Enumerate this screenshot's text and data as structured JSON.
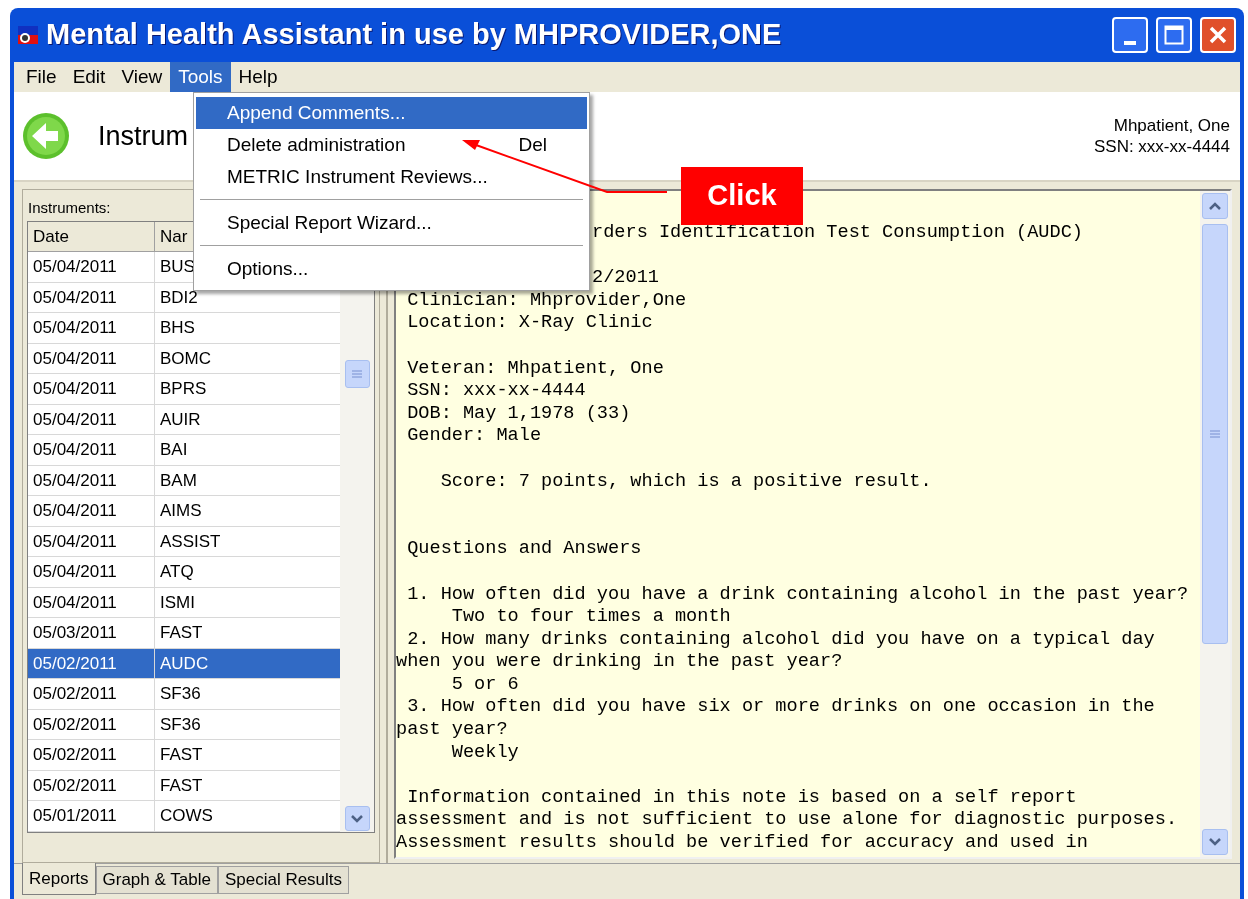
{
  "window": {
    "title": "Mental Health Assistant in use by MHPROVIDER,ONE"
  },
  "menu_bar": [
    {
      "label": "File",
      "selected": false
    },
    {
      "label": "Edit",
      "selected": false
    },
    {
      "label": "View",
      "selected": false
    },
    {
      "label": "Tools",
      "selected": true
    },
    {
      "label": "Help",
      "selected": false
    }
  ],
  "tools_menu": [
    {
      "kind": "item",
      "label": "Append Comments...",
      "selected": true
    },
    {
      "kind": "item",
      "label": "Delete administration",
      "shortcut": "Del",
      "selected": false
    },
    {
      "kind": "item",
      "label": "METRIC Instrument Reviews...",
      "selected": false
    },
    {
      "kind": "separator"
    },
    {
      "kind": "item",
      "label": "Special Report Wizard...",
      "selected": false
    },
    {
      "kind": "separator"
    },
    {
      "kind": "item",
      "label": "Options...",
      "selected": false
    }
  ],
  "header": {
    "title": "Instrum",
    "patient_name": "Mhpatient, One",
    "patient_ssn": "SSN: xxx-xx-4444"
  },
  "instruments": {
    "label": "Instruments:",
    "columns": [
      "Date",
      "Nar"
    ],
    "rows": [
      {
        "date": "05/04/2011",
        "name": "BUS",
        "selected": false
      },
      {
        "date": "05/04/2011",
        "name": "BDI2",
        "selected": false
      },
      {
        "date": "05/04/2011",
        "name": "BHS",
        "selected": false
      },
      {
        "date": "05/04/2011",
        "name": "BOMC",
        "selected": false
      },
      {
        "date": "05/04/2011",
        "name": "BPRS",
        "selected": false
      },
      {
        "date": "05/04/2011",
        "name": "AUIR",
        "selected": false
      },
      {
        "date": "05/04/2011",
        "name": "BAI",
        "selected": false
      },
      {
        "date": "05/04/2011",
        "name": "BAM",
        "selected": false
      },
      {
        "date": "05/04/2011",
        "name": "AIMS",
        "selected": false
      },
      {
        "date": "05/04/2011",
        "name": "ASSIST",
        "selected": false
      },
      {
        "date": "05/04/2011",
        "name": "ATQ",
        "selected": false
      },
      {
        "date": "05/04/2011",
        "name": "ISMI",
        "selected": false
      },
      {
        "date": "05/03/2011",
        "name": "FAST",
        "selected": false
      },
      {
        "date": "05/02/2011",
        "name": "AUDC",
        "selected": true
      },
      {
        "date": "05/02/2011",
        "name": "SF36",
        "selected": false
      },
      {
        "date": "05/02/2011",
        "name": "SF36",
        "selected": false
      },
      {
        "date": "05/02/2011",
        "name": "FAST",
        "selected": false
      },
      {
        "date": "05/02/2011",
        "name": "FAST",
        "selected": false
      },
      {
        "date": "05/01/2011",
        "name": "COWS",
        "selected": false
      }
    ]
  },
  "report": {
    "lines": [
      {
        "kind": "cut",
        "text": "rders Identification Test Consumption (AUDC)"
      },
      {
        "kind": "blank"
      },
      {
        "kind": "cut",
        "text": "2/2011"
      },
      {
        "kind": "line",
        "text": " Clinician: Mhprovider,One"
      },
      {
        "kind": "line",
        "text": " Location: X-Ray Clinic"
      },
      {
        "kind": "blank"
      },
      {
        "kind": "line",
        "text": " Veteran: Mhpatient, One"
      },
      {
        "kind": "line",
        "text": " SSN: xxx-xx-4444"
      },
      {
        "kind": "line",
        "text": " DOB: May 1,1978 (33)"
      },
      {
        "kind": "line",
        "text": " Gender: Male"
      },
      {
        "kind": "blank"
      },
      {
        "kind": "line",
        "text": "    Score: 7 points, which is a positive result."
      },
      {
        "kind": "blank"
      },
      {
        "kind": "blank"
      },
      {
        "kind": "line",
        "text": " Questions and Answers"
      },
      {
        "kind": "blank"
      },
      {
        "kind": "line",
        "text": " 1. How often did you have a drink containing alcohol in the past year?"
      },
      {
        "kind": "line",
        "text": "     Two to four times a month"
      },
      {
        "kind": "line",
        "text": " 2. How many drinks containing alcohol did you have on a typical day"
      },
      {
        "kind": "line",
        "text": "when you were drinking in the past year?"
      },
      {
        "kind": "line",
        "text": "     5 or 6"
      },
      {
        "kind": "line",
        "text": " 3. How often did you have six or more drinks on one occasion in the"
      },
      {
        "kind": "line",
        "text": "past year?"
      },
      {
        "kind": "line",
        "text": "     Weekly"
      },
      {
        "kind": "blank"
      },
      {
        "kind": "line",
        "text": " Information contained in this note is based on a self report"
      },
      {
        "kind": "line",
        "text": "assessment and is not sufficient to use alone for diagnostic purposes."
      },
      {
        "kind": "line",
        "text": "Assessment results should be verified for accuracy and used in"
      }
    ]
  },
  "tabs": [
    {
      "label": "Reports",
      "selected": true
    },
    {
      "label": "Graph & Table",
      "selected": false
    },
    {
      "label": "Special Results",
      "selected": false
    }
  ],
  "callout": {
    "label": "Click"
  }
}
